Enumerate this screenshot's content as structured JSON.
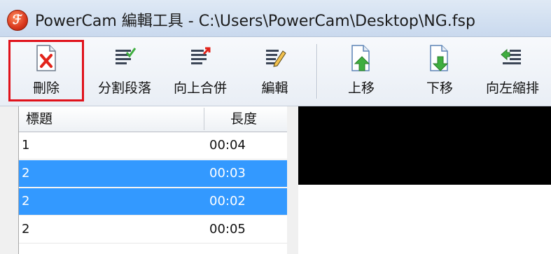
{
  "window": {
    "title": "PowerCam 編輯工具 - C:\\Users\\PowerCam\\Desktop\\NG.fsp",
    "app_icon": "powercam-logo"
  },
  "toolbar": {
    "buttons": [
      {
        "label": "刪除",
        "icon": "delete-document-icon",
        "selected": true
      },
      {
        "label": "分割段落",
        "icon": "split-paragraph-icon"
      },
      {
        "label": "向上合併",
        "icon": "merge-up-icon"
      },
      {
        "label": "編輯",
        "icon": "edit-pencil-icon"
      },
      {
        "label": "上移",
        "icon": "move-up-icon"
      },
      {
        "label": "下移",
        "icon": "move-down-icon"
      },
      {
        "label": "向左縮排",
        "icon": "outdent-left-icon"
      }
    ]
  },
  "list": {
    "columns": [
      "標題",
      "長度"
    ],
    "rows": [
      {
        "title": "1",
        "length": "00:04",
        "selected": false
      },
      {
        "title": "2",
        "length": "00:03",
        "selected": true
      },
      {
        "title": "2",
        "length": "00:02",
        "selected": true
      },
      {
        "title": "2",
        "length": "00:05",
        "selected": false
      }
    ]
  },
  "colors": {
    "selection": "#3399ff",
    "highlight_box": "#e0121b",
    "arrow_green": "#3fae3f",
    "delete_red": "#e2231a"
  }
}
